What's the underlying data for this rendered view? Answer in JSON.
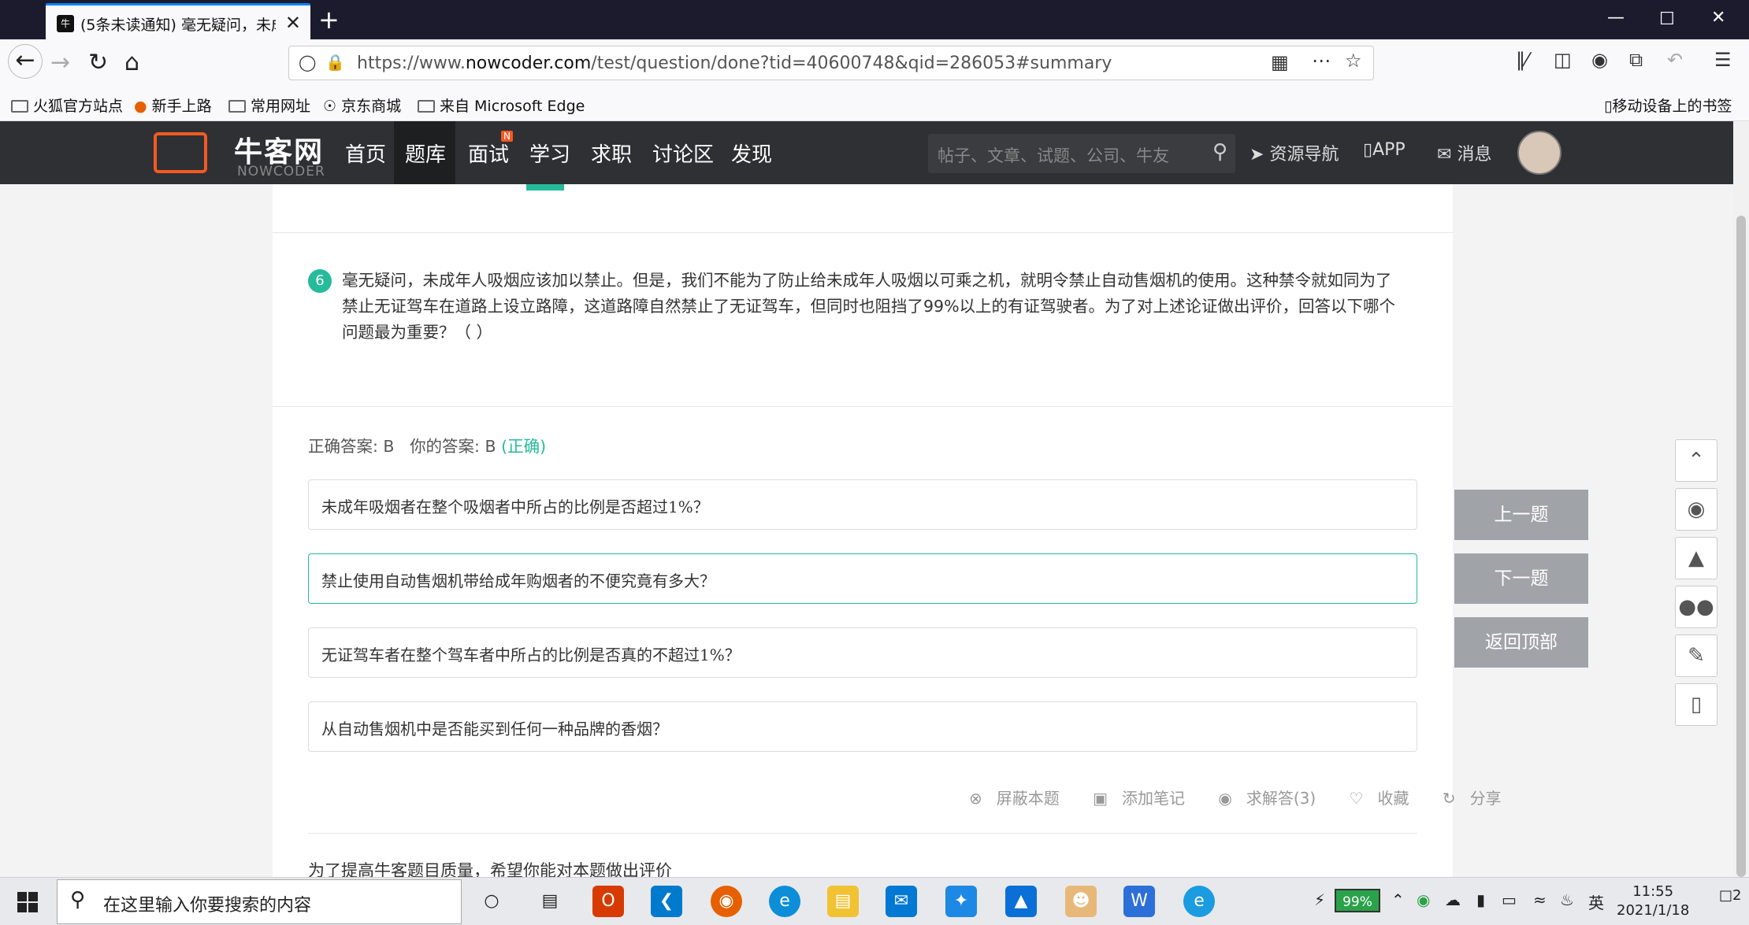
{
  "browser": {
    "tab_title": "(5条未读通知) 毫无疑问，未成",
    "tab_close": "✕",
    "new_tab": "+",
    "url_prefix": "https://www.",
    "url_domain": "nowcoder.com",
    "url_path": "/test/question/done?tid=40600748&qid=286053#summary",
    "bookmarks": [
      "火狐官方站点",
      "新手上路",
      "常用网址",
      "京东商城",
      "来自 Microsoft Edge"
    ],
    "mobile_bookmarks": "移动设备上的书签"
  },
  "site": {
    "logo_text": "牛客网",
    "logo_sub": "NOWCODER",
    "menu": [
      "首页",
      "题库",
      "面试",
      "学习",
      "求职",
      "讨论区",
      "发现"
    ],
    "interview_badge": "N",
    "search_placeholder": "帖子、文章、试题、公司、牛友",
    "links": {
      "resources": "资源导航",
      "app": "APP",
      "messages": "消息"
    }
  },
  "question": {
    "number": "6",
    "text": "毫无疑问，未成年人吸烟应该加以禁止。但是，我们不能为了防止给未成年人吸烟以可乘之机，就明令禁止自动售烟机的使用。这种禁令就如同为了禁止无证驾车在道路上设立路障，这道路障自然禁止了无证驾车，但同时也阻挡了99%以上的有证驾驶者。为了对上述论证做出评价，回答以下哪个问题最为重要？（ ）",
    "correct_answer_label": "正确答案: B",
    "your_answer_label": "你的答案: B",
    "result": "(正确)",
    "options": [
      "未成年吸烟者在整个吸烟者中所占的比例是否超过1%？",
      "禁止使用自动售烟机带给成年购烟者的不便究竟有多大？",
      "无证驾车者在整个驾车者中所占的比例是否真的不超过1%？",
      "从自动售烟机中是否能买到任何一种品牌的香烟？"
    ],
    "selected_option": 1,
    "actions": [
      "屏蔽本题",
      "添加笔记",
      "求解答(3)",
      "收藏",
      "分享"
    ],
    "rate_prompt": "为了提高牛客题目质量，希望你能对本题做出评价"
  },
  "side": {
    "prev": "上一题",
    "next": "下一题",
    "top": "返回顶部"
  },
  "taskbar": {
    "search_placeholder": "在这里输入你要搜索的内容",
    "battery": "99%",
    "ime": "英",
    "time": "11:55",
    "date": "2021/1/18",
    "notifications": "2"
  }
}
